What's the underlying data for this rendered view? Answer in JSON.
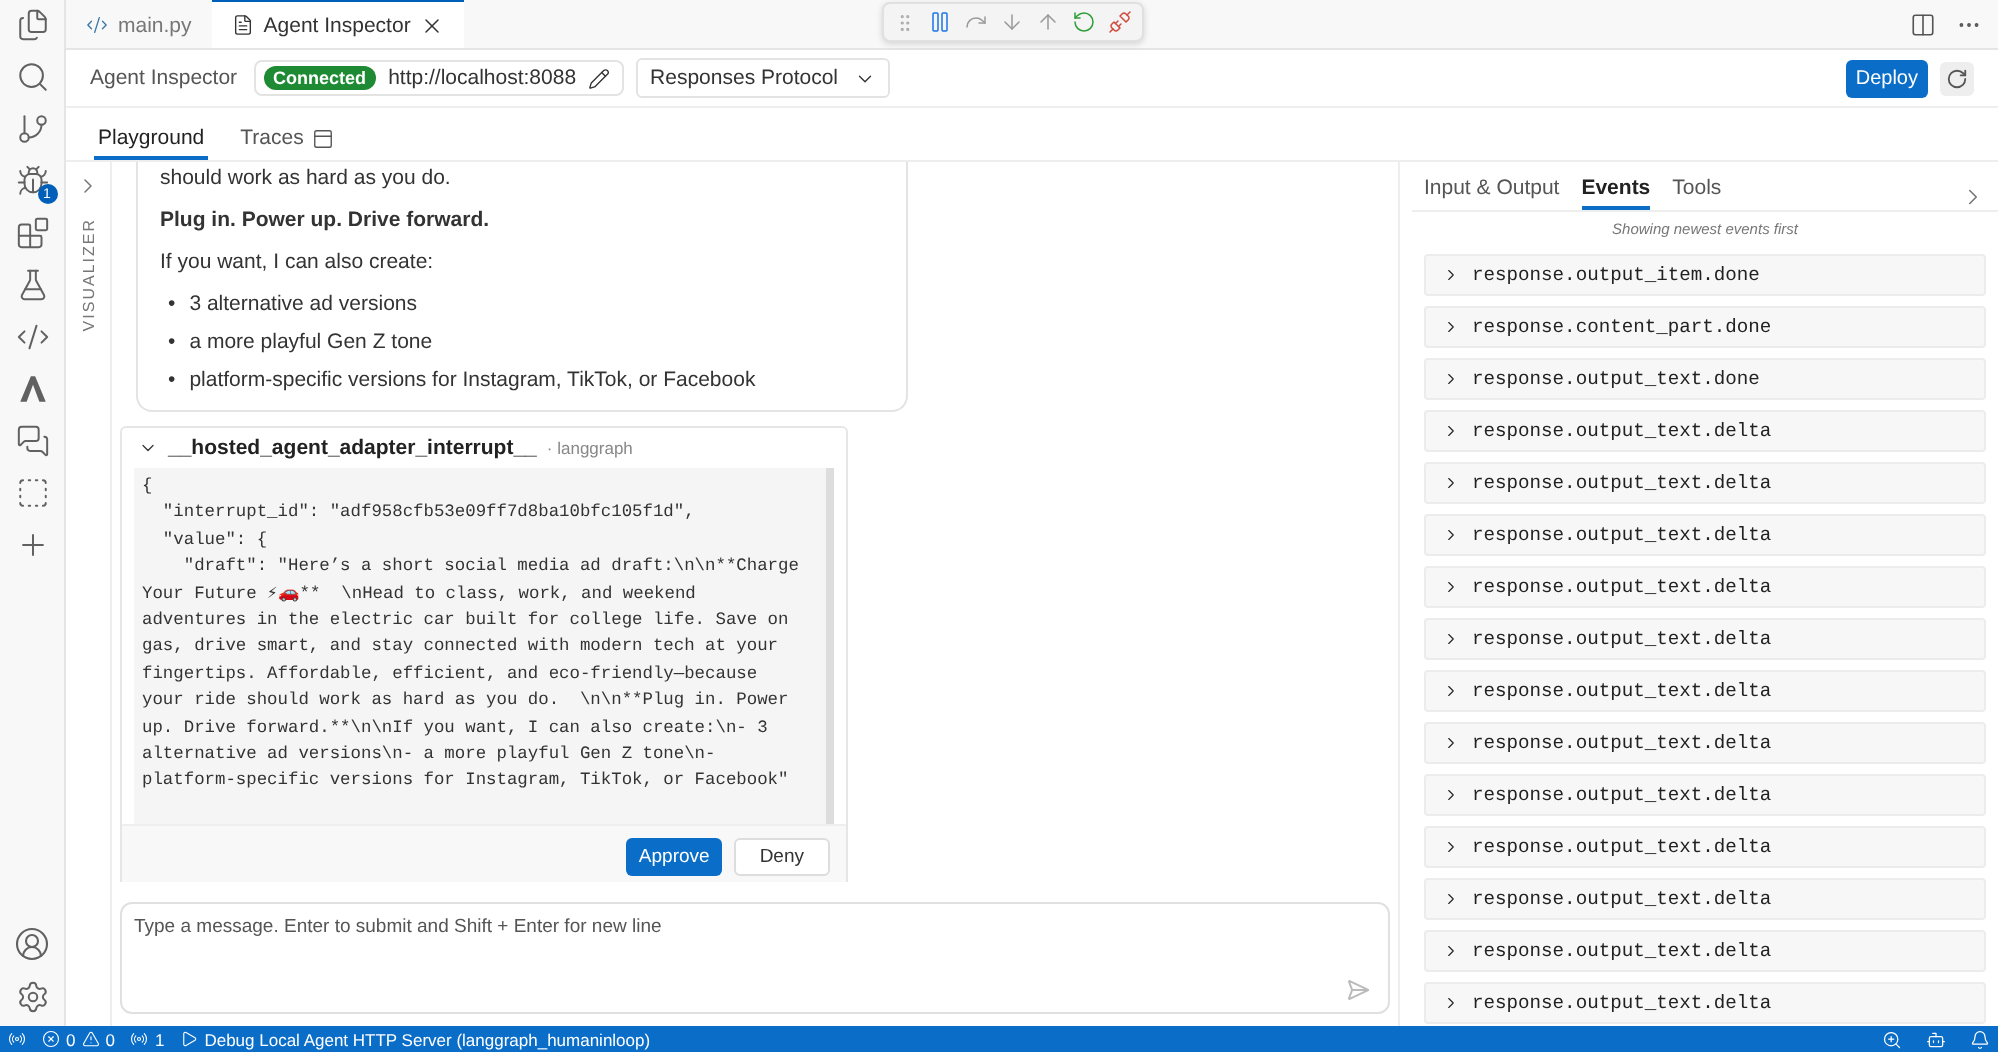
{
  "editor_tabs": [
    {
      "label": "main.py",
      "kind": "python",
      "selected": false
    },
    {
      "label": "Agent Inspector",
      "kind": "doc",
      "selected": true
    }
  ],
  "activity_badge": "1",
  "header": {
    "title": "Agent Inspector",
    "status": "Connected",
    "url": "http://localhost:8088",
    "protocol": "Responses Protocol",
    "deploy": "Deploy"
  },
  "view_tabs": [
    {
      "label": "Playground",
      "selected": true
    },
    {
      "label": "Traces",
      "selected": false
    }
  ],
  "visualizer": "VISUALIZER",
  "message": {
    "lines": [
      "should work as hard as you do."
    ],
    "bold": "Plug in. Power up. Drive forward.",
    "intro": "If you want, I can also create:",
    "marker": "•",
    "bullets": [
      "3 alternative ad versions",
      "a more playful Gen Z tone",
      "platform-specific versions for Instagram, TikTok, or Facebook"
    ]
  },
  "interrupt": {
    "title": "__hosted_agent_adapter_interrupt__",
    "source": "· langgraph",
    "expanded": true,
    "code": [
      "{",
      "  \"interrupt_id\": \"adf958cfb53e09ff7d8ba10bfc105f1d\",",
      "  \"value\": {",
      "    \"draft\": \"Here’s a short social media ad draft:\\n\\n**Charge",
      "Your Future ⚡🚗**  \\nHead to class, work, and weekend",
      "adventures in the electric car built for college life. Save on",
      "gas, drive smart, and stay connected with modern tech at your",
      "fingertips. Affordable, efficient, and eco-friendly—because",
      "your ride should work as hard as you do.  \\n\\n**Plug in. Power",
      "up. Drive forward.**\\n\\nIf you want, I can also create:\\n- 3",
      "alternative ad versions\\n- a more playful Gen Z tone\\n-",
      "platform-specific versions for Instagram, TikTok, or Facebook\""
    ],
    "approve": "Approve",
    "deny": "Deny"
  },
  "composer": {
    "placeholder": "Type a message. Enter to submit and Shift + Enter for new line"
  },
  "panel_tabs": [
    {
      "label": "Input & Output",
      "selected": false
    },
    {
      "label": "Events",
      "selected": true
    },
    {
      "label": "Tools",
      "selected": false
    }
  ],
  "events_note": "Showing newest events first",
  "events": [
    "response.output_item.done",
    "response.content_part.done",
    "response.output_text.done",
    "response.output_text.delta",
    "response.output_text.delta",
    "response.output_text.delta",
    "response.output_text.delta",
    "response.output_text.delta",
    "response.output_text.delta",
    "response.output_text.delta",
    "response.output_text.delta",
    "response.output_text.delta",
    "response.output_text.delta",
    "response.output_text.delta",
    "response.output_text.delta"
  ],
  "status_bar": {
    "errors": "0",
    "warnings": "0",
    "ports": "1",
    "debug": "Debug Local Agent HTTP Server (langgraph_humaninloop)"
  }
}
